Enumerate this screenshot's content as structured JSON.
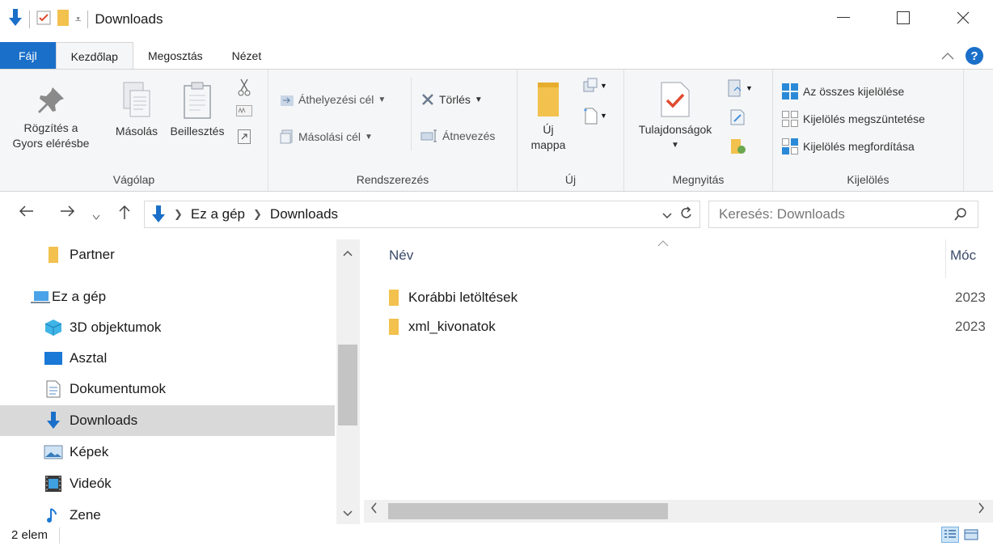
{
  "window": {
    "title": "Downloads",
    "controls": {
      "minimize": "—",
      "maximize": "☐",
      "close": "✕"
    }
  },
  "ribbon_tabs": [
    {
      "label": "Fájl"
    },
    {
      "label": "Kezdőlap"
    },
    {
      "label": "Megosztás"
    },
    {
      "label": "Nézet"
    }
  ],
  "ribbon": {
    "clipboard": {
      "pin_label_1": "Rögzítés a",
      "pin_label_2": "Gyors elérésbe",
      "copy_label": "Másolás",
      "paste_label": "Beillesztés",
      "group_label": "Vágólap"
    },
    "organize": {
      "move_to": "Áthelyezési cél",
      "copy_to": "Másolási cél",
      "delete": "Törlés",
      "rename": "Átnevezés",
      "group_label": "Rendszerezés"
    },
    "new": {
      "new_folder_1": "Új",
      "new_folder_2": "mappa",
      "group_label": "Új"
    },
    "open": {
      "properties": "Tulajdonságok",
      "group_label": "Megnyitás"
    },
    "select": {
      "select_all": "Az összes kijelölése",
      "select_none": "Kijelölés megszüntetése",
      "invert": "Kijelölés megfordítása",
      "group_label": "Kijelölés"
    }
  },
  "address": {
    "crumbs": [
      "Ez a gép",
      "Downloads"
    ],
    "search_placeholder": "Keresés: Downloads"
  },
  "nav_items": [
    {
      "label": "Partner",
      "icon": "folder-icon"
    },
    {
      "label": "Ez a gép",
      "icon": "computer-icon"
    },
    {
      "label": "3D objektumok",
      "icon": "cube-icon"
    },
    {
      "label": "Asztal",
      "icon": "desktop-icon"
    },
    {
      "label": "Dokumentumok",
      "icon": "document-icon"
    },
    {
      "label": "Downloads",
      "icon": "download-icon",
      "selected": true
    },
    {
      "label": "Képek",
      "icon": "pictures-icon"
    },
    {
      "label": "Videók",
      "icon": "video-icon"
    },
    {
      "label": "Zene",
      "icon": "music-icon"
    }
  ],
  "columns": {
    "name": "Név",
    "modified": "Móc"
  },
  "files": [
    {
      "name": "Korábbi letöltések",
      "date": "2023"
    },
    {
      "name": "xml_kivonatok",
      "date": "2023"
    }
  ],
  "status": {
    "count": "2 elem"
  },
  "colors": {
    "accent": "#1a6fc9",
    "folder": "#f2c14e",
    "selected": "#d9d9d9"
  }
}
